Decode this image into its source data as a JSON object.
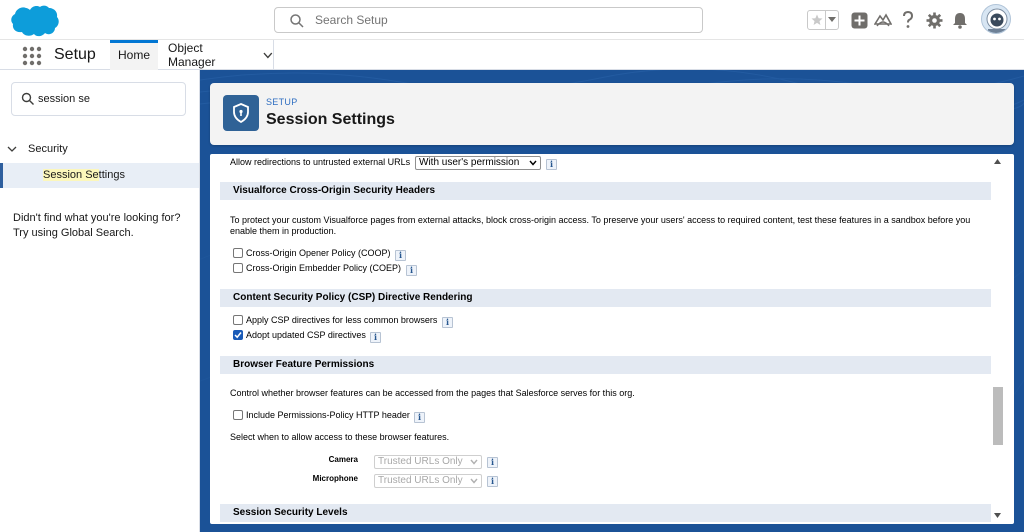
{
  "header": {
    "search_placeholder": "Search Setup"
  },
  "context_nav": {
    "app_name": "Setup",
    "tabs": [
      {
        "label": "Home"
      },
      {
        "label": "Object Manager"
      }
    ]
  },
  "sidebar": {
    "quickfind_value": "session se",
    "tree": {
      "node_label": "Security",
      "leaf_prefix": "Session Se",
      "leaf_suffix": "ttings"
    },
    "not_found_line1": "Didn't find what you're looking for?",
    "not_found_line2": "Try using Global Search."
  },
  "page_header": {
    "eyebrow": "SETUP",
    "title": "Session Settings"
  },
  "content": {
    "redirect_label": "Allow redirections to untrusted external URLs",
    "redirect_value": "With user's permission",
    "info_glyph": "i",
    "sections": {
      "visualforce": {
        "title": "Visualforce Cross-Origin Security Headers",
        "description_line1": "To protect your custom Visualforce pages from external attacks, block cross-origin access. To preserve your users' access to required content, test these features in a sandbox before you",
        "description_line2": "enable them in production.",
        "options": [
          {
            "label": "Cross-Origin Opener Policy (COOP)",
            "checked": false
          },
          {
            "label": "Cross-Origin Embedder Policy (COEP)",
            "checked": false
          }
        ]
      },
      "csp": {
        "title": "Content Security Policy (CSP) Directive Rendering",
        "options": [
          {
            "label": "Apply CSP directives for less common browsers",
            "checked": false
          },
          {
            "label": "Adopt updated CSP directives",
            "checked": true
          }
        ]
      },
      "browser": {
        "title": "Browser Feature Permissions",
        "description": "Control whether browser features can be accessed from the pages that Salesforce serves for this org.",
        "include_label": "Include Permissions-Policy HTTP header",
        "select_text": "Select when to allow access to these browser features.",
        "features": [
          {
            "label": "Camera",
            "value": "Trusted URLs Only"
          },
          {
            "label": "Microphone",
            "value": "Trusted URLs Only"
          }
        ]
      },
      "session_security": {
        "title": "Session Security Levels"
      }
    }
  },
  "colors": {
    "brand_blue": "#0176d3",
    "page_bg": "#1b5297",
    "section_bg": "#e3e9f2",
    "highlight": "#fcf7bb"
  }
}
